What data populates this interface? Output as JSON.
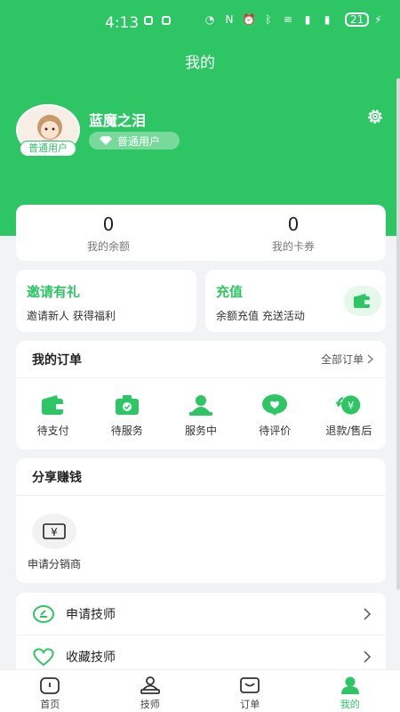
{
  "status_bar": {
    "time": "4:13",
    "battery": "21"
  },
  "header": {
    "title": "我的"
  },
  "profile": {
    "username": "蓝魔之泪",
    "avatar_badge": "普通用户",
    "level_label": "普通用户"
  },
  "balance": {
    "amount_value": "0",
    "amount_label": "我的余额",
    "coupons_value": "0",
    "coupons_label": "我的卡券"
  },
  "promos": {
    "invite_title": "邀请有礼",
    "invite_subtitle": "邀请新人 获得福利",
    "recharge_title": "充值",
    "recharge_subtitle": "余额充值 充送活动"
  },
  "orders": {
    "title": "我的订单",
    "all_link": "全部订单",
    "items": [
      {
        "label": "待支付",
        "icon": "wallet-icon"
      },
      {
        "label": "待服务",
        "icon": "camera-icon"
      },
      {
        "label": "服务中",
        "icon": "person-icon"
      },
      {
        "label": "待评价",
        "icon": "heart-chat-icon"
      },
      {
        "label": "退款/售后",
        "icon": "refund-icon"
      }
    ]
  },
  "share": {
    "title": "分享赚钱",
    "items": [
      {
        "label": "申请分销商",
        "icon": "yen-icon"
      }
    ]
  },
  "menu": {
    "items": [
      {
        "label": "申请技师",
        "icon": "apply-icon"
      },
      {
        "label": "收藏技师",
        "icon": "heart-icon"
      }
    ]
  },
  "tabbar": {
    "items": [
      {
        "label": "首页",
        "icon": "home-icon"
      },
      {
        "label": "技师",
        "icon": "technician-icon"
      },
      {
        "label": "订单",
        "icon": "order-icon"
      },
      {
        "label": "我的",
        "icon": "profile-icon"
      }
    ],
    "active_index": 3
  },
  "colors": {
    "brand_green": "#2ec664",
    "background": "#f2f3f5"
  }
}
